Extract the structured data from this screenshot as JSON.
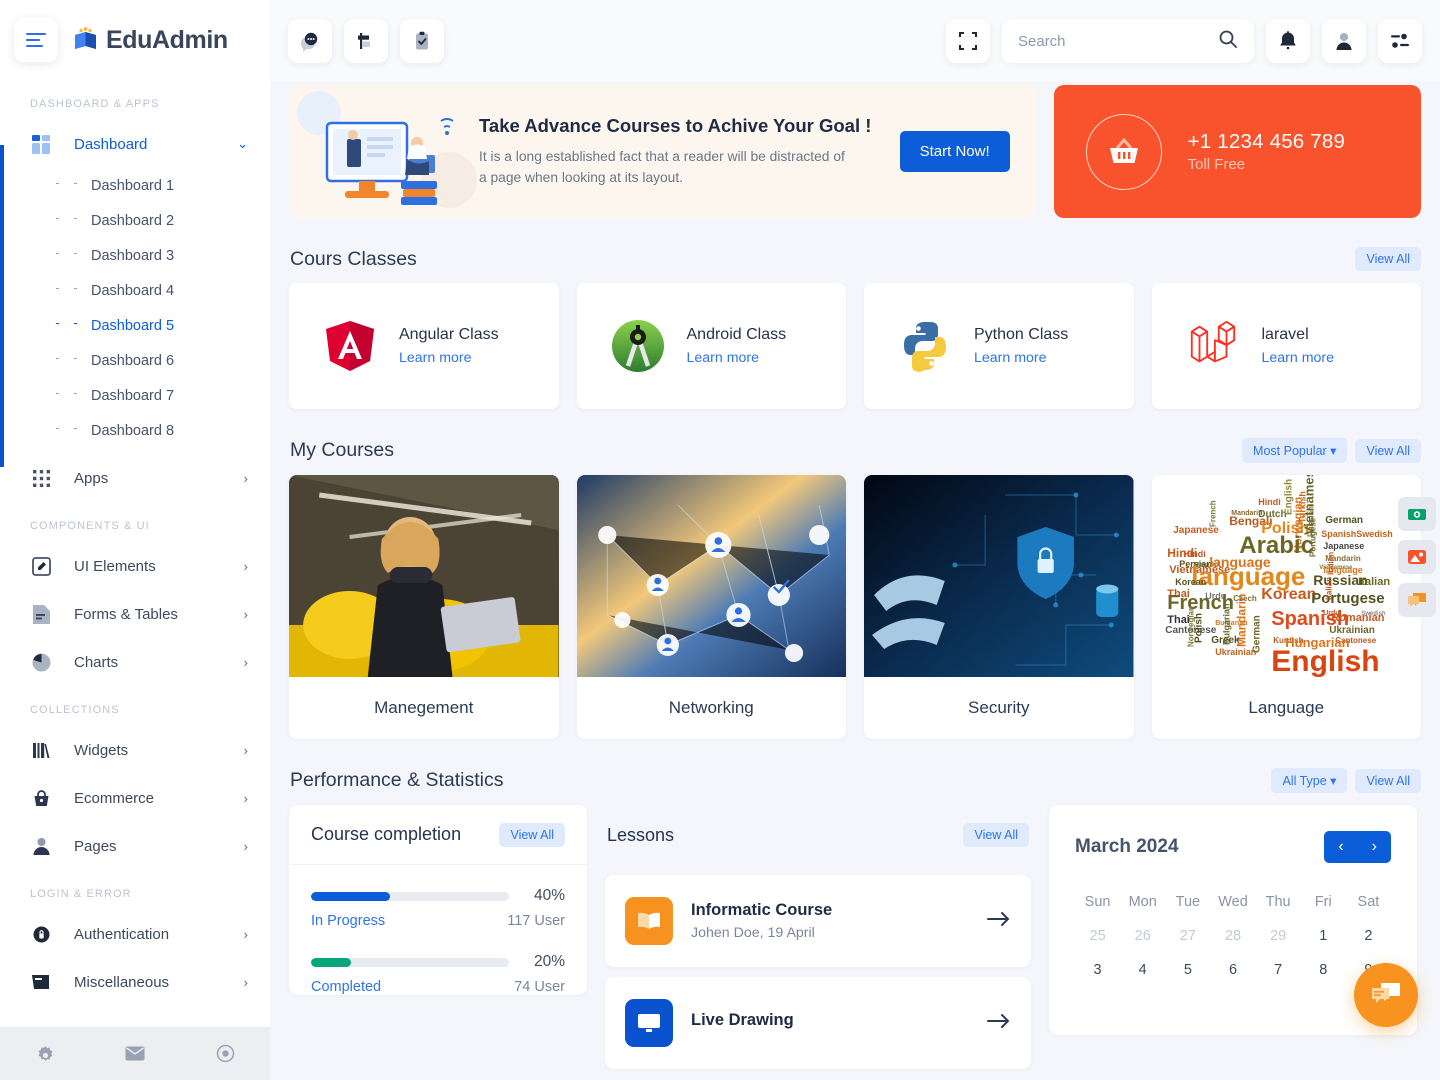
{
  "brand": {
    "name": "EduAdmin",
    "logo_icon": "book-star-logo"
  },
  "sidebar": {
    "toggle_icon": "hamburger-menu-icon",
    "sections": [
      {
        "label": "DASHBOARD & APPS"
      },
      {
        "label": "COMPONENTS & UI"
      },
      {
        "label": "COLLECTIONS"
      },
      {
        "label": "LOGIN & ERROR"
      }
    ],
    "dashboard": {
      "label": "Dashboard",
      "icon": "grid-icon",
      "chevron": "chevron-down-icon"
    },
    "dashboard_children": [
      "Dashboard 1",
      "Dashboard 2",
      "Dashboard 3",
      "Dashboard 4",
      "Dashboard 5",
      "Dashboard 6",
      "Dashboard 7",
      "Dashboard 8"
    ],
    "selected_child": "Dashboard 5",
    "items": [
      {
        "label": "Apps",
        "icon": "apps-grid-icon"
      },
      {
        "label": "UI Elements",
        "icon": "pencil-square-icon"
      },
      {
        "label": "Forms & Tables",
        "icon": "document-icon"
      },
      {
        "label": "Charts",
        "icon": "pie-chart-icon"
      },
      {
        "label": "Widgets",
        "icon": "books-icon"
      },
      {
        "label": "Ecommerce",
        "icon": "basket-icon"
      },
      {
        "label": "Pages",
        "icon": "user-icon"
      },
      {
        "label": "Authentication",
        "icon": "lock-icon"
      },
      {
        "label": "Miscellaneous",
        "icon": "archive-icon"
      }
    ],
    "footer_icons": [
      "gear-icon",
      "envelope-icon",
      "power-icon"
    ]
  },
  "header": {
    "left_icons": [
      "chat-bubble-icon",
      "signpost-icon",
      "clipboard-check-icon"
    ],
    "fullscreen_icon": "fullscreen-icon",
    "search": {
      "placeholder": "Search",
      "value": "",
      "icon": "search-icon"
    },
    "right_icons": [
      "bell-icon",
      "user-avatar-icon",
      "sliders-icon"
    ]
  },
  "hero": {
    "title": "Take Advance Courses to Achive Your Goal !",
    "subtitle": "It is a long established fact that a reader will be distracted of a page when looking at its layout.",
    "button": "Start Now!",
    "illustration": "elearning-illustration"
  },
  "phone_card": {
    "icon": "shopping-basket-icon",
    "number": "+1 1234 456 789",
    "label": "Toll Free",
    "color": "#f9532e"
  },
  "cours_classes": {
    "title": "Cours Classes",
    "view_all": "View All",
    "cards": [
      {
        "name": "Angular Class",
        "link": "Learn more",
        "logo": "angular-logo"
      },
      {
        "name": "Android Class",
        "link": "Learn more",
        "logo": "android-studio-logo"
      },
      {
        "name": "Python Class",
        "link": "Learn more",
        "logo": "python-logo"
      },
      {
        "name": "laravel",
        "link": "Learn more",
        "logo": "laravel-logo"
      }
    ]
  },
  "my_courses": {
    "title": "My Courses",
    "filter": "Most Popular",
    "view_all": "View All",
    "cards": [
      {
        "caption": "Manegement",
        "image": "woman-with-laptop-photo"
      },
      {
        "caption": "Networking",
        "image": "network-nodes-photo"
      },
      {
        "caption": "Security",
        "image": "cyber-security-photo"
      },
      {
        "caption": "Language",
        "image": "language-word-cloud"
      }
    ]
  },
  "performance": {
    "title": "Performance & Statistics",
    "filter": "All Type",
    "view_all": "View All"
  },
  "course_completion": {
    "title": "Course completion",
    "view_all": "View All",
    "rows": [
      {
        "label": "In Progress",
        "percent": "40%",
        "value": 40,
        "users": "117 User",
        "color": "#0b5ed7"
      },
      {
        "label": "Completed",
        "percent": "20%",
        "value": 20,
        "users": "74 User",
        "color": "#06a77d"
      }
    ]
  },
  "lessons": {
    "title": "Lessons",
    "view_all": "View All",
    "items": [
      {
        "title": "Informatic Course",
        "meta": "Johen Doe, 19 April",
        "icon": "open-book-icon",
        "color": "#f79220",
        "arrow": "arrow-right-icon"
      },
      {
        "title": "Live Drawing",
        "meta": "",
        "icon": "monitor-icon",
        "color": "#0b53ce",
        "arrow": "arrow-right-icon"
      }
    ]
  },
  "calendar": {
    "month": "March 2024",
    "prev_icon": "chevron-left-icon",
    "next_icon": "chevron-right-icon",
    "dow": [
      "Sun",
      "Mon",
      "Tue",
      "Wed",
      "Thu",
      "Fri",
      "Sat"
    ],
    "weeks": [
      [
        {
          "d": "25",
          "muted": true
        },
        {
          "d": "26",
          "muted": true
        },
        {
          "d": "27",
          "muted": true
        },
        {
          "d": "28",
          "muted": true
        },
        {
          "d": "29",
          "muted": true
        },
        {
          "d": "1",
          "muted": false
        },
        {
          "d": "2",
          "muted": false
        }
      ],
      [
        {
          "d": "3",
          "muted": false
        },
        {
          "d": "4",
          "muted": false
        },
        {
          "d": "5",
          "muted": false
        },
        {
          "d": "6",
          "muted": false
        },
        {
          "d": "7",
          "muted": false
        },
        {
          "d": "8",
          "muted": false
        },
        {
          "d": "9",
          "muted": false
        }
      ]
    ]
  },
  "floating": {
    "buttons": [
      {
        "icon": "camera-icon",
        "color": "#0aa06e"
      },
      {
        "icon": "image-icon",
        "color": "#f9532e"
      },
      {
        "icon": "chat-icon",
        "color": "#f7931e"
      }
    ],
    "chat_fab": {
      "icon": "chat-bubbles-icon",
      "color": "#f7931e"
    }
  },
  "word_cloud": {
    "words": [
      "English",
      "Spanish",
      "Arabic",
      "language",
      "French",
      "Mandarin",
      "Korean",
      "Portugese",
      "Russian",
      "Japanese",
      "Polish",
      "Hindi",
      "Vietnamese",
      "German",
      "Italian",
      "Thai",
      "Bengali",
      "Dutch",
      "Turkish",
      "Norwegian",
      "Swedish",
      "Greek",
      "Czech",
      "Hungarian",
      "Romanian",
      "Ukrainian",
      "Cantonese",
      "Bulgarian",
      "Persian",
      "Urdu"
    ]
  }
}
